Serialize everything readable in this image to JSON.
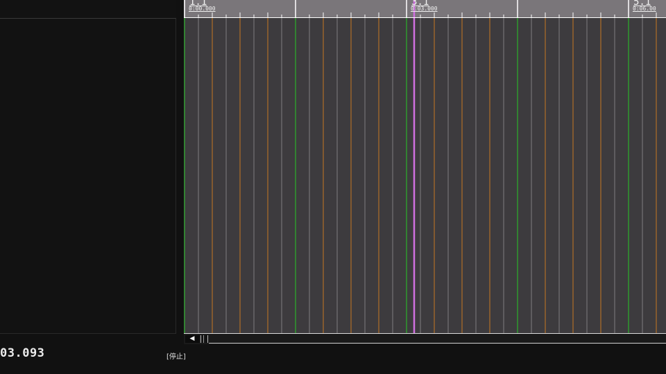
{
  "ruler": {
    "markers": [
      {
        "measure": "1.1",
        "time": "0:00.000"
      },
      {
        "measure": "3.1",
        "time": "0:03.000"
      },
      {
        "measure": "5.1",
        "time": "0:06.00"
      }
    ]
  },
  "timeline": {
    "playhead_color": "#d070e0",
    "bar_line_color": "#2e9a2e",
    "beat_line_color": "#a86a28",
    "sub_line_color": "#7e7c80",
    "background": "#3d3b3e"
  },
  "transport": {
    "time_display": "03.093",
    "status": "[停止]"
  },
  "icons": {
    "scroll_left": "left-arrow-icon"
  }
}
